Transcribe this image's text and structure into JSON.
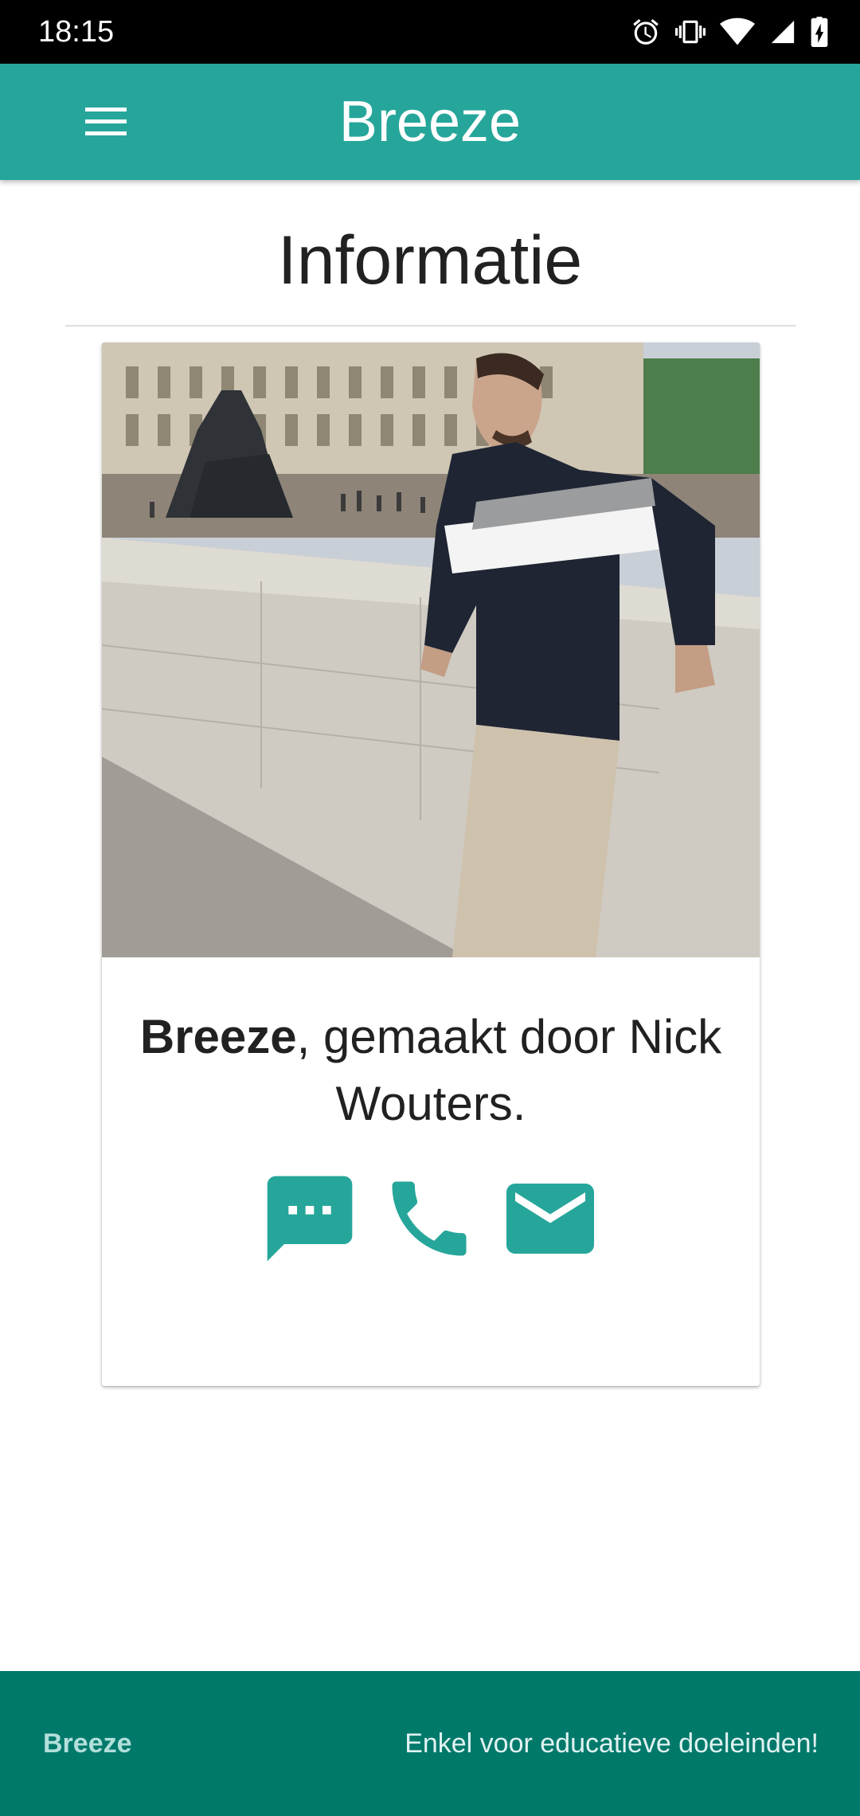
{
  "status_bar": {
    "time": "18:15",
    "icons": [
      "alarm-icon",
      "vibrate-icon",
      "wifi-icon",
      "signal-icon",
      "battery-charging-icon"
    ]
  },
  "app_bar": {
    "title": "Breeze",
    "menu_icon": "hamburger-menu-icon"
  },
  "page": {
    "title": "Informatie"
  },
  "card": {
    "image_description": "photo",
    "text_bold": "Breeze",
    "text_rest": ", gemaakt door Nick Wouters.",
    "actions": [
      {
        "name": "message-icon"
      },
      {
        "name": "phone-icon"
      },
      {
        "name": "email-icon"
      }
    ]
  },
  "footer": {
    "left": "Breeze",
    "right": "Enkel voor educatieve doeleinden!"
  },
  "colors": {
    "primary": "#26a69a",
    "footer": "#00796b",
    "accent_icons": "#26a69a"
  }
}
